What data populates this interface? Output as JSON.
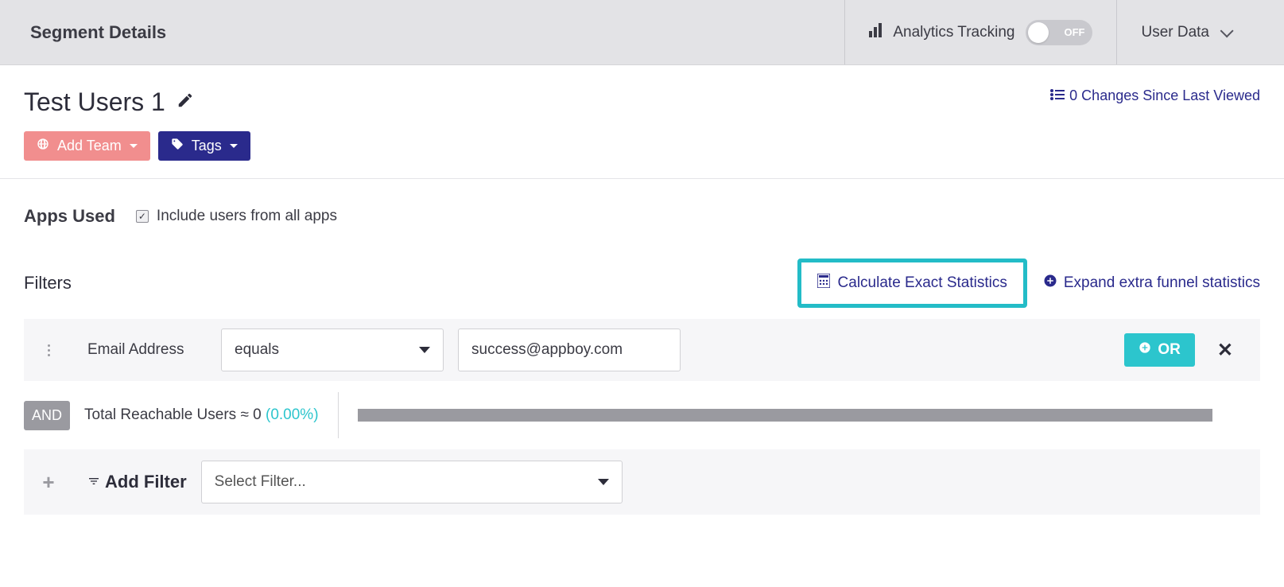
{
  "header": {
    "title": "Segment Details",
    "analytics_label": "Analytics Tracking",
    "toggle_state": "OFF",
    "user_data_label": "User Data"
  },
  "segment": {
    "name": "Test Users 1",
    "changes_link": "0 Changes Since Last Viewed",
    "add_team_label": "Add Team",
    "tags_label": "Tags"
  },
  "apps": {
    "section_label": "Apps Used",
    "include_all_label": "Include users from all apps",
    "include_all_checked": true
  },
  "filters": {
    "section_label": "Filters",
    "calc_label": "Calculate Exact Statistics",
    "expand_label": "Expand extra funnel statistics",
    "row": {
      "field_label": "Email Address",
      "operator": "equals",
      "value": "success@appboy.com",
      "or_label": "OR"
    },
    "and_label": "AND",
    "reach_label": "Total Reachable Users ≈ 0 ",
    "reach_pct": "(0.00%)",
    "add_filter_label": "Add Filter",
    "select_filter_placeholder": "Select Filter..."
  }
}
